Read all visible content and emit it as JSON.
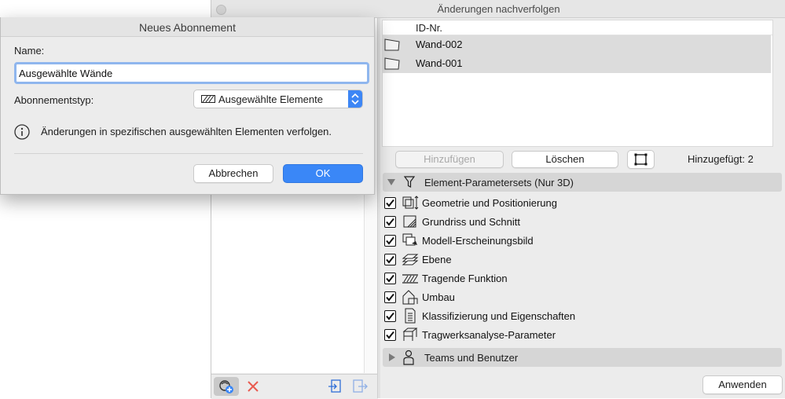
{
  "background_window": {
    "title": "Änderungen nachverfolgen",
    "id_column_header": "ID-Nr.",
    "rows": [
      {
        "id": "Wand-002",
        "icon": "wall-icon"
      },
      {
        "id": "Wand-001",
        "icon": "wall-icon"
      }
    ],
    "buttons": {
      "add": "Hinzufügen",
      "delete": "Löschen",
      "apply": "Anwenden"
    },
    "added_label": "Hinzugefügt: 2",
    "group_element": {
      "label": "Element-Parametersets (Nur 3D)",
      "expanded": true
    },
    "group_teams": {
      "label": "Teams und Benutzer",
      "expanded": false
    },
    "parameter_items": [
      {
        "label": "Geometrie und Positionierung",
        "checked": true,
        "icon": "geometry-icon"
      },
      {
        "label": "Grundriss und Schnitt",
        "checked": true,
        "icon": "floorplan-icon"
      },
      {
        "label": "Modell-Erscheinungsbild",
        "checked": true,
        "icon": "model-appearance-icon"
      },
      {
        "label": "Ebene",
        "checked": true,
        "icon": "layer-icon"
      },
      {
        "label": "Tragende Funktion",
        "checked": true,
        "icon": "structural-function-icon"
      },
      {
        "label": "Umbau",
        "checked": true,
        "icon": "renovation-icon"
      },
      {
        "label": "Klassifizierung und Eigenschaften",
        "checked": true,
        "icon": "classification-icon"
      },
      {
        "label": "Tragwerksanalyse-Parameter",
        "checked": true,
        "icon": "structural-analysis-icon"
      }
    ]
  },
  "dialog": {
    "title": "Neues Abonnement",
    "name_label": "Name:",
    "name_value": "Ausgewählte Wände",
    "type_label": "Abonnementstyp:",
    "type_value": "Ausgewählte Elemente",
    "info_text": "Änderungen in spezifischen ausgewählten Elementen verfolgen.",
    "cancel_label": "Abbrechen",
    "ok_label": "OK"
  },
  "colors": {
    "accent": "#3a87f7",
    "selection_gray": "#dcdcdc",
    "focus_ring": "#8fb6ee"
  }
}
